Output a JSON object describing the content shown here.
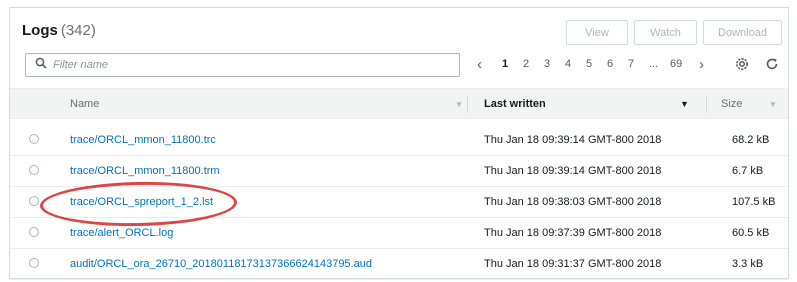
{
  "header": {
    "title": "Logs",
    "count": "(342)"
  },
  "actions": {
    "view_label": "View",
    "watch_label": "Watch",
    "download_label": "Download"
  },
  "search": {
    "placeholder": "Filter name",
    "value": ""
  },
  "pagination": {
    "pages": [
      "1",
      "2",
      "3",
      "4",
      "5",
      "6",
      "7",
      "...",
      "69"
    ],
    "current": "1"
  },
  "columns": {
    "name": "Name",
    "last_written": "Last written",
    "size": "Size"
  },
  "rows": [
    {
      "name": "trace/ORCL_mmon_11800.trc",
      "last_written": "Thu Jan 18 09:39:14 GMT-800 2018",
      "size": "68.2 kB"
    },
    {
      "name": "trace/ORCL_mmon_11800.trm",
      "last_written": "Thu Jan 18 09:39:14 GMT-800 2018",
      "size": "6.7 kB"
    },
    {
      "name": "trace/ORCL_spreport_1_2.lst",
      "last_written": "Thu Jan 18 09:38:03 GMT-800 2018",
      "size": "107.5 kB"
    },
    {
      "name": "trace/alert_ORCL.log",
      "last_written": "Thu Jan 18 09:37:39 GMT-800 2018",
      "size": "60.5 kB"
    },
    {
      "name": "audit/ORCL_ora_26710_20180118173137366624143795.aud",
      "last_written": "Thu Jan 18 09:31:37 GMT-800 2018",
      "size": "3.3 kB"
    }
  ],
  "colors": {
    "link": "#0073bb",
    "annotation": "#e04545",
    "header_bg": "#f2f3f3"
  },
  "icons": [
    "search-icon",
    "chevron-left-icon",
    "chevron-right-icon",
    "gear-icon",
    "refresh-icon",
    "sort-caret-icon"
  ]
}
